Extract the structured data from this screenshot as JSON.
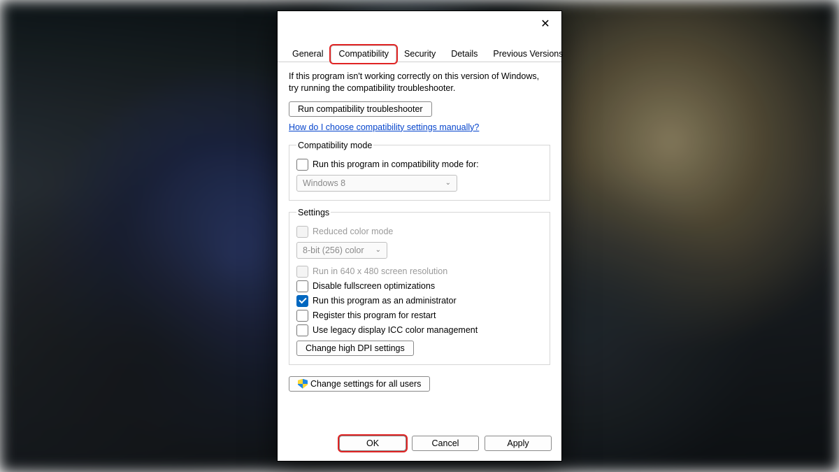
{
  "tabs": {
    "general": "General",
    "compatibility": "Compatibility",
    "security": "Security",
    "details": "Details",
    "previous_versions": "Previous Versions"
  },
  "intro_text": "If this program isn't working correctly on this version of Windows, try running the compatibility troubleshooter.",
  "run_troubleshooter_label": "Run compatibility troubleshooter",
  "help_link": "How do I choose compatibility settings manually?",
  "compat_mode": {
    "legend": "Compatibility mode",
    "checkbox_label": "Run this program in compatibility mode for:",
    "selected": "Windows 8"
  },
  "settings": {
    "legend": "Settings",
    "reduced_color_label": "Reduced color mode",
    "color_selected": "8-bit (256) color",
    "run_640_label": "Run in 640 x 480 screen resolution",
    "disable_fullscreen_label": "Disable fullscreen optimizations",
    "run_admin_label": "Run this program as an administrator",
    "register_restart_label": "Register this program for restart",
    "legacy_icc_label": "Use legacy display ICC color management",
    "change_dpi_label": "Change high DPI settings"
  },
  "change_all_users_label": "Change settings for all users",
  "footer": {
    "ok": "OK",
    "cancel": "Cancel",
    "apply": "Apply"
  }
}
